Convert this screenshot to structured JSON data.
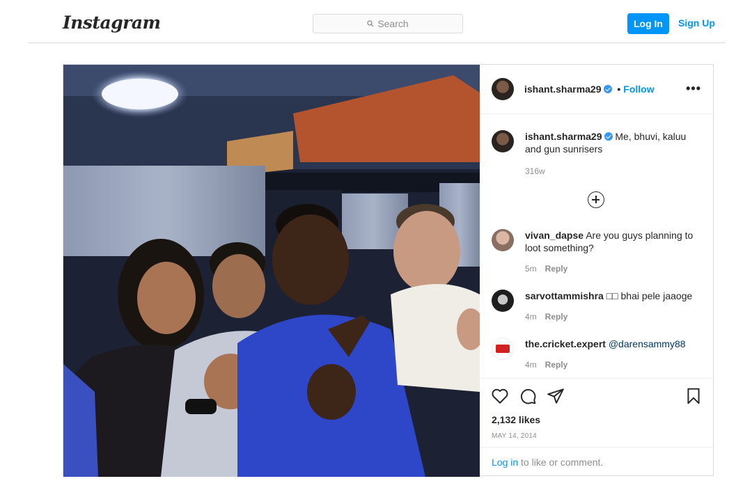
{
  "header": {
    "logo": "Instagram",
    "search_placeholder": "Search",
    "login_label": "Log In",
    "signup_label": "Sign Up"
  },
  "post": {
    "author": {
      "username": "ishant.sharma29",
      "verified": true,
      "follow_label": "Follow",
      "separator": "•"
    },
    "caption": {
      "username": "ishant.sharma29",
      "text": "Me, bhuvi, kaluu and gun sunrisers",
      "time": "316w"
    },
    "comments": [
      {
        "username": "vivan_dapse",
        "text": "Are you guys planning to loot something?",
        "time": "5m",
        "reply": "Reply"
      },
      {
        "username": "sarvottammishra",
        "text": "□□ bhai pele jaaoge",
        "time": "4m",
        "reply": "Reply"
      },
      {
        "username": "the.cricket.expert",
        "text": "@darensammy88",
        "time": "4m",
        "reply": "Reply"
      }
    ],
    "likes": "2,132 likes",
    "date": "MAY 14, 2014",
    "login_prompt": {
      "link": "Log in",
      "text": " to like or comment."
    }
  },
  "colors": {
    "accent": "#0095f6",
    "text": "#262626",
    "muted": "#8e8e8e",
    "border": "#dbdbdb",
    "verified": "#3897f0"
  },
  "icons": [
    "search-icon",
    "verified-icon",
    "more-icon",
    "load-more-icon",
    "heart-icon",
    "comment-icon",
    "share-icon",
    "bookmark-icon"
  ]
}
